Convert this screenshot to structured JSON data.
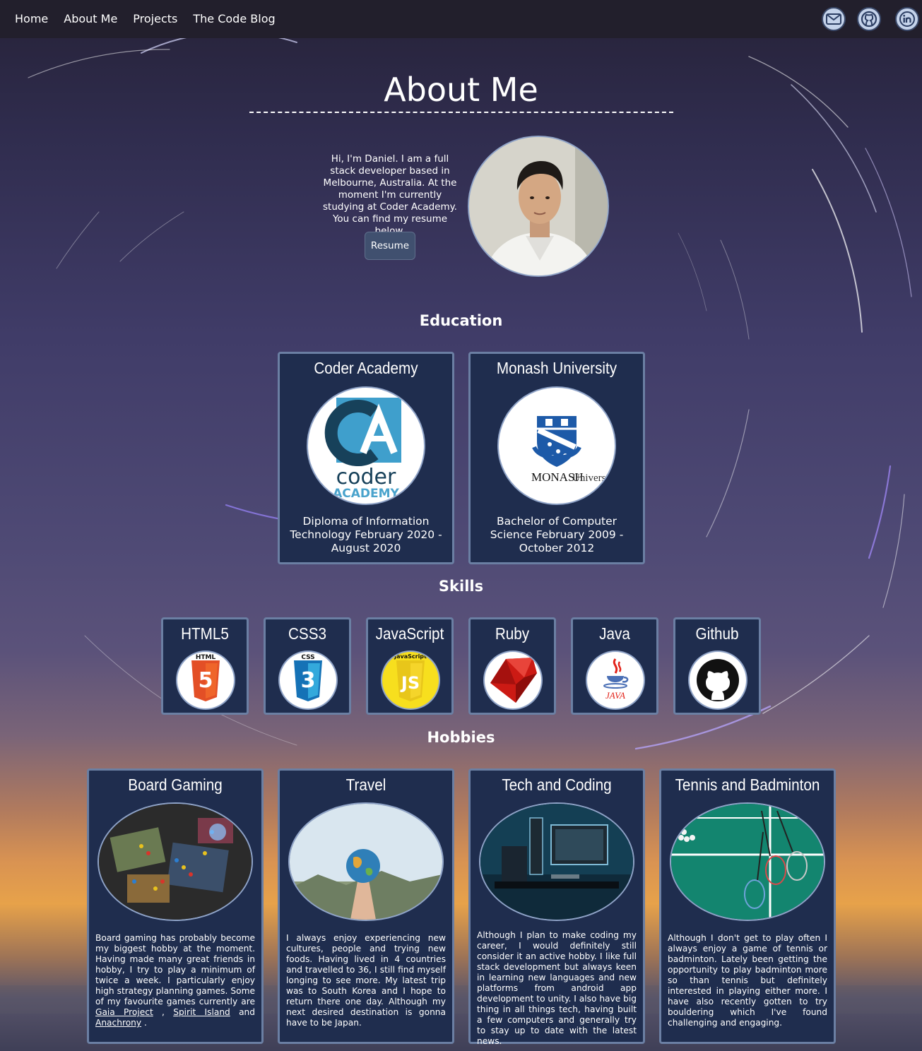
{
  "nav": {
    "links": [
      "Home",
      "About Me",
      "Projects",
      "The Code Blog"
    ],
    "social_icons": [
      "mail-icon",
      "github-icon",
      "linkedin-icon"
    ]
  },
  "page_title": "About Me",
  "intro": {
    "text": "Hi, I'm Daniel. I am a full stack developer based in Melbourne, Australia. At the moment I'm currently studying at Coder Academy. You can find my resume below.",
    "resume_label": "Resume"
  },
  "education": {
    "title": "Education",
    "cards": [
      {
        "name": "Coder Academy",
        "logo_top": "coder",
        "logo_bottom": "ACADEMY",
        "desc": "Diploma of Information Technology February 2020 - August 2020"
      },
      {
        "name": "Monash University",
        "logo_text_bold": "MONASH",
        "logo_text": "University",
        "desc": "Bachelor of Computer Science February 2009 - October 2012"
      }
    ]
  },
  "skills": {
    "title": "Skills",
    "items": [
      {
        "name": "HTML5",
        "icon": "html5-icon",
        "badge": "5",
        "badge_label": "HTML"
      },
      {
        "name": "CSS3",
        "icon": "css3-icon",
        "badge": "3",
        "badge_label": "CSS"
      },
      {
        "name": "JavaScript",
        "icon": "js-icon",
        "badge": "JS",
        "badge_label": "JavaScript"
      },
      {
        "name": "Ruby",
        "icon": "ruby-icon"
      },
      {
        "name": "Java",
        "icon": "java-icon",
        "badge_label": "JAVA"
      },
      {
        "name": "Github",
        "icon": "github-icon"
      }
    ]
  },
  "hobbies": {
    "title": "Hobbies",
    "cards": [
      {
        "name": "Board Gaming",
        "text_before": "Board gaming has probably become my biggest hobby at the moment. Having made many great friends in hobby, I try to play a minimum of twice a week. I particularly enjoy high strategy planning games. Some of my favourite games currently are ",
        "link1": "Gaia Project",
        "sep1": " , ",
        "link2": "Spirit Island",
        "sep2": " and ",
        "link3": "Anachrony",
        "text_after": " ."
      },
      {
        "name": "Travel",
        "text": "I always enjoy experiencing new cultures, people and trying new foods. Having lived in 4 countries and travelled to 36, I still find myself longing to see more. My latest trip was to South Korea and I hope to return there one day. Although my next desired destination is gonna have to be Japan."
      },
      {
        "name": "Tech and Coding",
        "text": "Although I plan to make coding my career, I would definitely still consider it an active hobby. I like full stack development but always keen in learning new languages and new platforms from android app development to unity. I also have big thing in all things tech, having built a few computers and generally try to stay up to date with the latest news."
      },
      {
        "name": "Tennis and Badminton",
        "text": "Although I don't get to play often I always enjoy a game of tennis or badminton. Lately been getting the opportunity to play badminton more so than tennis but definitely interested in playing either more. I have also recently gotten to try bouldering which I've found challenging and engaging."
      }
    ]
  },
  "colors": {
    "navbar": "#221f2c",
    "card_bg": "#1f2d4e",
    "card_border": "#6b7fa3",
    "button_bg": "#40506f"
  }
}
